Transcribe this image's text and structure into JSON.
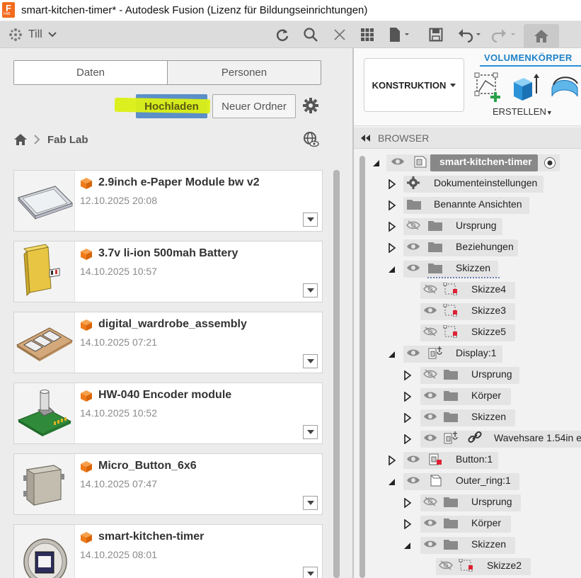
{
  "window": {
    "title": "smart-kitchen-timer* - Autodesk Fusion (Lizenz für Bildungseinrichtungen)",
    "logo_text": "F",
    "logo_sub": "FAB"
  },
  "toolbar": {
    "user_name": "Till",
    "icons": [
      "grid-dots-icon",
      "refresh-icon",
      "search-icon",
      "close-icon",
      "apps-grid-icon",
      "file-icon",
      "save-icon",
      "undo-icon",
      "redo-icon",
      "home-icon"
    ]
  },
  "data_panel": {
    "tabs": [
      {
        "label": "Daten",
        "active": true
      },
      {
        "label": "Personen",
        "active": false
      }
    ],
    "upload_label": "Hochladen",
    "new_folder_label": "Neuer Ordner",
    "breadcrumb": "Fab Lab",
    "items": [
      {
        "name": "2.9inch e-Paper Module bw v2",
        "date": "12.10.2025 20:08"
      },
      {
        "name": "3.7v li-ion 500mah Battery",
        "date": "14.10.2025 10:57"
      },
      {
        "name": "digital_wardrobe_assembly",
        "date": "14.10.2025 07:21"
      },
      {
        "name": "HW-040 Encoder module",
        "date": "14.10.2025 10:52"
      },
      {
        "name": "Micro_Button_6x6",
        "date": "14.10.2025 07:47"
      },
      {
        "name": "smart-kitchen-timer",
        "date": "14.10.2025 08:01"
      }
    ]
  },
  "design_panel": {
    "workspace_label": "KONSTRUKTION",
    "active_tab": "VOLUMENKÖRPER",
    "group_label": "ERSTELLEN",
    "browser_label": "BROWSER",
    "tree": {
      "root": "smart-kitchen-timer",
      "doc_settings": "Dokumenteinstellungen",
      "named_views": "Benannte Ansichten",
      "origin": "Ursprung",
      "relations": "Beziehungen",
      "sketches": "Skizzen",
      "sketch4": "Skizze4",
      "sketch3": "Skizze3",
      "sketch5": "Skizze5",
      "display": "Display:1",
      "d_origin": "Ursprung",
      "d_bodies": "Körper",
      "d_sketches": "Skizzen",
      "d_link": "Wavehsare 1.54in e-",
      "button": "Button:1",
      "outer": "Outer_ring:1",
      "o_origin": "Ursprung",
      "o_bodies": "Körper",
      "o_sketches": "Skizzen",
      "o_sketch2": "Skizze2"
    }
  },
  "colors": {
    "accent_blue": "#1f82c7",
    "fusion_orange": "#f26b1d",
    "upload_button": "#5b8fc7",
    "highlighter": "#dcf014"
  }
}
